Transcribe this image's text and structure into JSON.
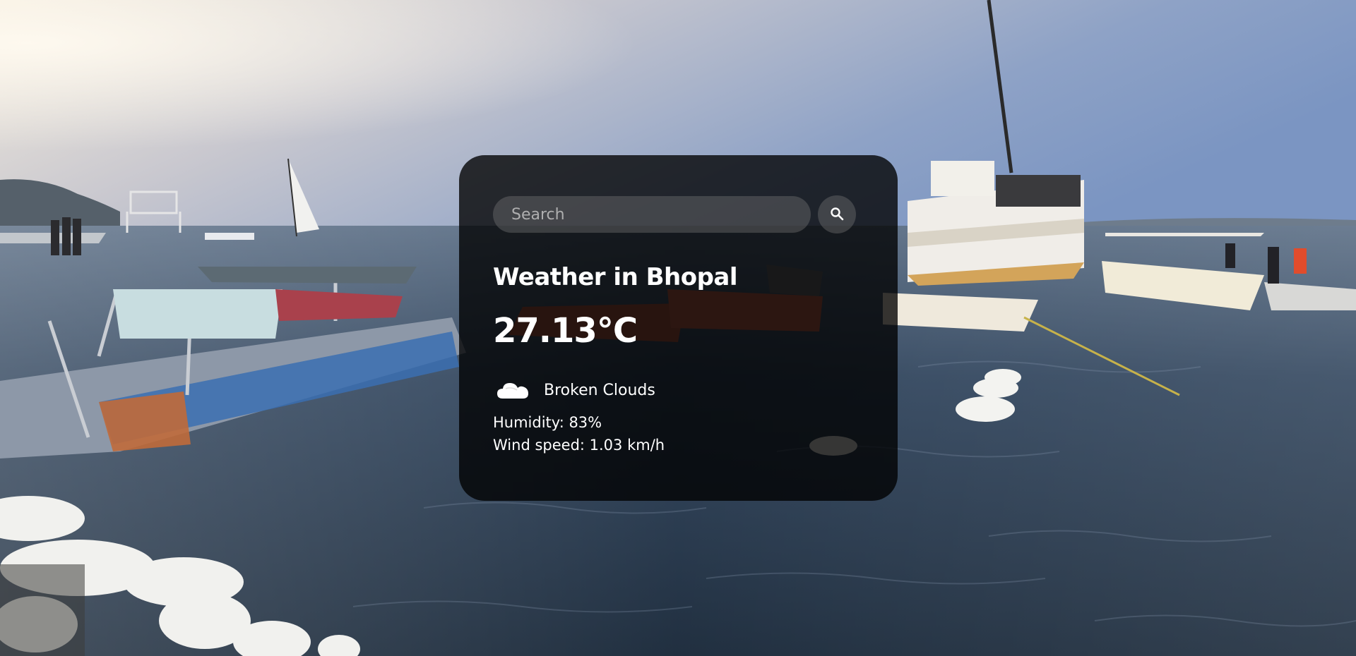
{
  "search": {
    "placeholder": "Search",
    "button_icon": "search-icon"
  },
  "weather": {
    "city_heading": "Weather in Bhopal",
    "temperature": "27.13°C",
    "condition_icon": "cloud-icon",
    "description": "Broken Clouds",
    "humidity": "Humidity: 83%",
    "wind_speed": "Wind speed: 1.03 km/h"
  },
  "colors": {
    "card_background": "#000000",
    "text": "#ffffff",
    "search_field": "#7c7c7c"
  }
}
